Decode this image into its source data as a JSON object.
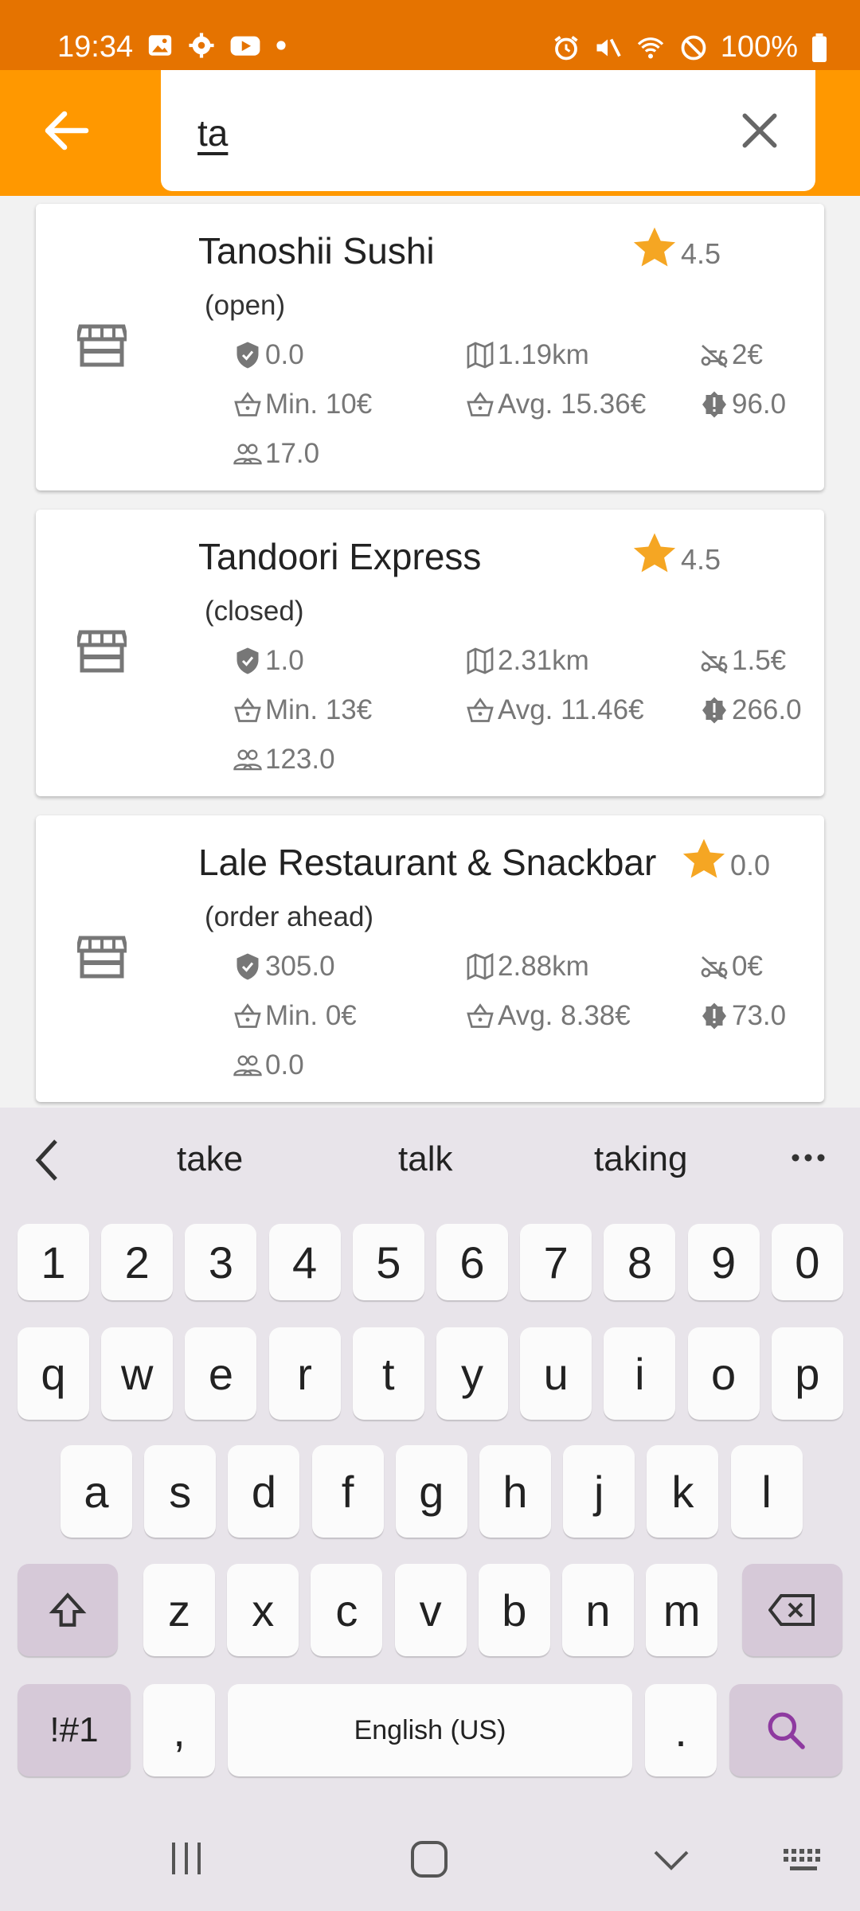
{
  "status_bar": {
    "time": "19:34",
    "battery": "100%"
  },
  "search": {
    "query": "ta"
  },
  "restaurants": [
    {
      "name": "Tanoshii Sushi",
      "rating": "4.5",
      "status": "(open)",
      "score": "0.0",
      "distance": "1.19km",
      "delivery_fee": "2€",
      "min_order": "Min. 10€",
      "avg_order": "Avg. 15.36€",
      "badge_value": "96.0",
      "people": "17.0"
    },
    {
      "name": "Tandoori Express",
      "rating": "4.5",
      "status": "(closed)",
      "score": "1.0",
      "distance": "2.31km",
      "delivery_fee": "1.5€",
      "min_order": "Min. 13€",
      "avg_order": "Avg. 11.46€",
      "badge_value": "266.0",
      "people": "123.0"
    },
    {
      "name": "Lale Restaurant & Snackbar",
      "rating": "0.0",
      "status": "(order ahead)",
      "score": "305.0",
      "distance": "2.88km",
      "delivery_fee": "0€",
      "min_order": "Min. 0€",
      "avg_order": "Avg. 8.38€",
      "badge_value": "73.0",
      "people": "0.0"
    }
  ],
  "keyboard": {
    "suggestions": [
      "take",
      "talk",
      "taking"
    ],
    "numbers": [
      "1",
      "2",
      "3",
      "4",
      "5",
      "6",
      "7",
      "8",
      "9",
      "0"
    ],
    "row1": [
      "q",
      "w",
      "e",
      "r",
      "t",
      "y",
      "u",
      "i",
      "o",
      "p"
    ],
    "row2": [
      "a",
      "s",
      "d",
      "f",
      "g",
      "h",
      "j",
      "k",
      "l"
    ],
    "row3": [
      "z",
      "x",
      "c",
      "v",
      "b",
      "n",
      "m"
    ],
    "symbols": "!#1",
    "comma": ",",
    "space": "English (US)",
    "period": "."
  },
  "colors": {
    "status_bar": "#e57300",
    "app_bar": "#ff9800",
    "star": "#f5a623",
    "search_key": "#d6c9d8"
  }
}
